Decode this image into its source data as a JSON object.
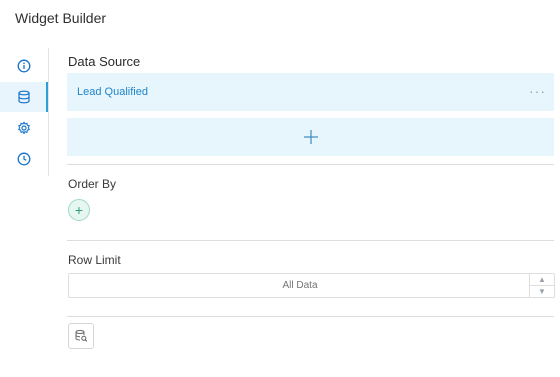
{
  "header": {
    "title": "Widget Builder"
  },
  "sidebar": {
    "items": [
      {
        "icon": "info-icon"
      },
      {
        "icon": "database-icon",
        "active": true
      },
      {
        "icon": "gear-icon"
      },
      {
        "icon": "clock-icon"
      }
    ]
  },
  "data_source": {
    "label": "Data Source",
    "item_name": "Lead Qualified",
    "more": "···"
  },
  "order_by": {
    "label": "Order By",
    "add": "+"
  },
  "row_limit": {
    "label": "Row Limit",
    "placeholder": "All Data"
  },
  "colors": {
    "accent": "#2b9fd8",
    "panel": "#e7f5fd",
    "link": "#1f86c8",
    "green": "#2e9f7f"
  }
}
